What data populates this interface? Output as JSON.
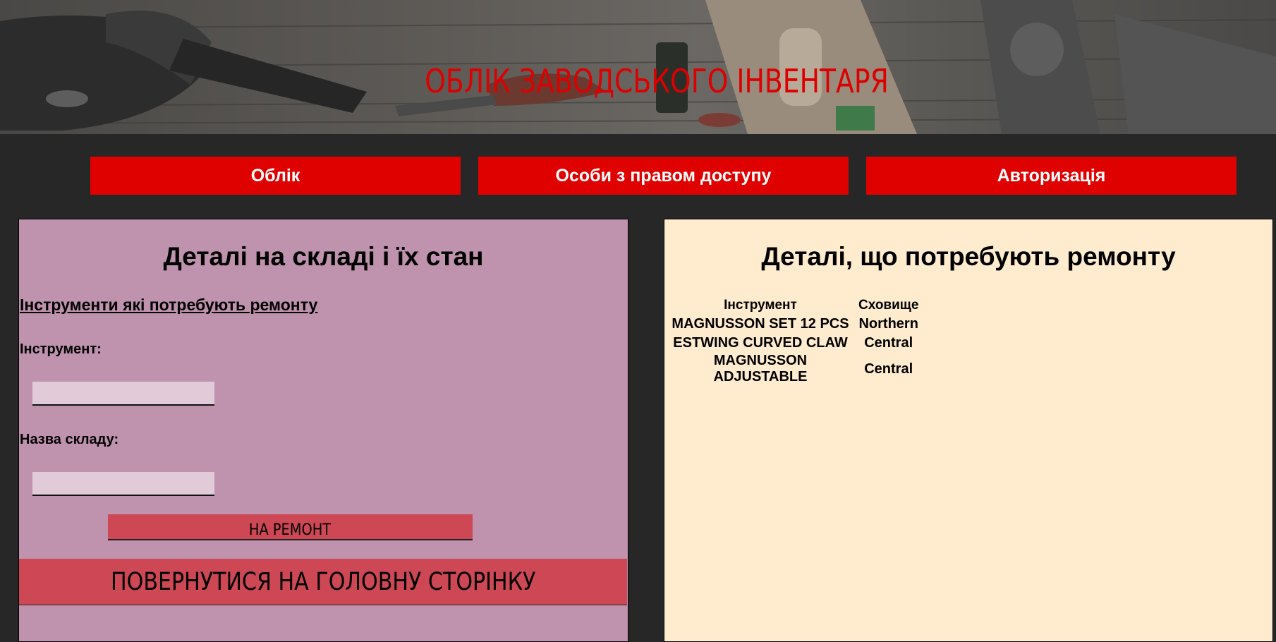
{
  "header": {
    "title": "ОБЛІК ЗАВОДСЬКОГО ІНВЕНТАРЯ"
  },
  "nav": {
    "items": [
      {
        "label": "Облік"
      },
      {
        "label": "Особи з правом доступу"
      },
      {
        "label": "Авторизація"
      }
    ]
  },
  "left_panel": {
    "title": "Деталі на складі і їх стан",
    "section_link": "Інструменти які потребують ремонту",
    "tool_label": "Інструмент:",
    "tool_value": "",
    "storage_label": "Назва складу:",
    "storage_value": "",
    "repair_button": "НА РЕМОНТ",
    "back_button": "ПОВЕРНУТИСЯ НА ГОЛОВНУ СТОРІНКУ"
  },
  "right_panel": {
    "title": "Деталі, що потребують ремонту",
    "columns": [
      "Інструмент",
      "Сховище"
    ],
    "rows": [
      [
        "MAGNUSSON SET 12 PCS",
        "Northern"
      ],
      [
        "ESTWING CURVED CLAW",
        "Central"
      ],
      [
        "MAGNUSSON ADJUSTABLE",
        "Central"
      ]
    ]
  },
  "colors": {
    "accent_red": "#df0000",
    "button_rose": "#cd4854",
    "left_panel_bg": "#bf92ad",
    "right_panel_bg": "#ffebcd",
    "page_bg": "#272727"
  }
}
